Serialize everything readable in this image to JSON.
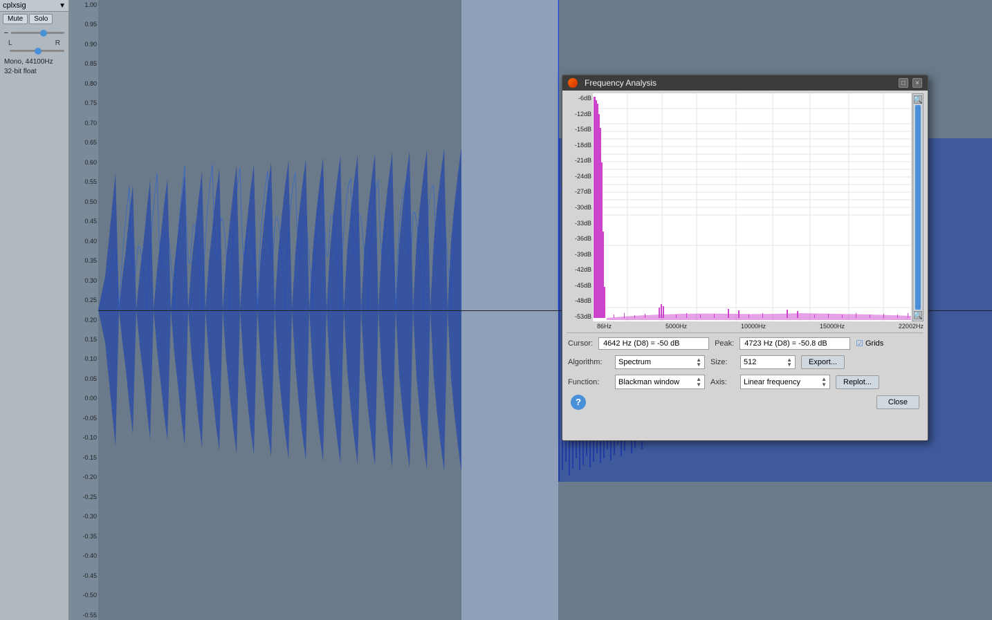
{
  "app": {
    "title": "Frequency Analysis"
  },
  "left_panel": {
    "track_name": "cplxsig",
    "mute_label": "Mute",
    "solo_label": "Solo",
    "gain_label": "–",
    "track_info_line1": "Mono, 44100Hz",
    "track_info_line2": "32-bit float",
    "lr_left": "L",
    "lr_right": "R"
  },
  "y_axis": {
    "labels": [
      "1.00",
      "0.95",
      "0.90",
      "0.85",
      "0.80",
      "0.75",
      "0.70",
      "0.65",
      "0.60",
      "0.55",
      "0.50",
      "0.45",
      "0.40",
      "0.35",
      "0.30",
      "0.25",
      "0.20",
      "0.15",
      "0.10",
      "0.05",
      "0.00",
      "-0.05",
      "-0.10",
      "-0.15",
      "-0.20",
      "-0.25",
      "-0.30",
      "-0.35",
      "-0.40",
      "-0.45",
      "-0.50",
      "-0.55"
    ]
  },
  "freq_dialog": {
    "title": "Frequency Analysis",
    "minimize_label": "□",
    "close_label": "×",
    "chart": {
      "y_labels": [
        "-6dB",
        "-12dB",
        "-15dB",
        "-18dB",
        "-21dB",
        "-24dB",
        "-27dB",
        "-30dB",
        "-33dB",
        "-36dB",
        "-39dB",
        "-42dB",
        "-45dB",
        "-48dB",
        "-53dB"
      ],
      "x_labels": [
        "86Hz",
        "5000Hz",
        "10000Hz",
        "15000Hz",
        "22002Hz"
      ]
    },
    "cursor_label": "Cursor:",
    "cursor_value": "4642 Hz (D8) = -50 dB",
    "peak_label": "Peak:",
    "peak_value": "4723 Hz (D8) = -50.8 dB",
    "grids_label": "Grids",
    "algorithm_label": "Algorithm:",
    "algorithm_value": "Spectrum",
    "size_label": "Size:",
    "size_value": "512",
    "export_label": "Export...",
    "function_label": "Function:",
    "function_value": "Blackman window",
    "axis_label": "Axis:",
    "axis_value": "Linear frequency",
    "replot_label": "Replot...",
    "help_label": "?",
    "close_btn_label": "Close"
  }
}
